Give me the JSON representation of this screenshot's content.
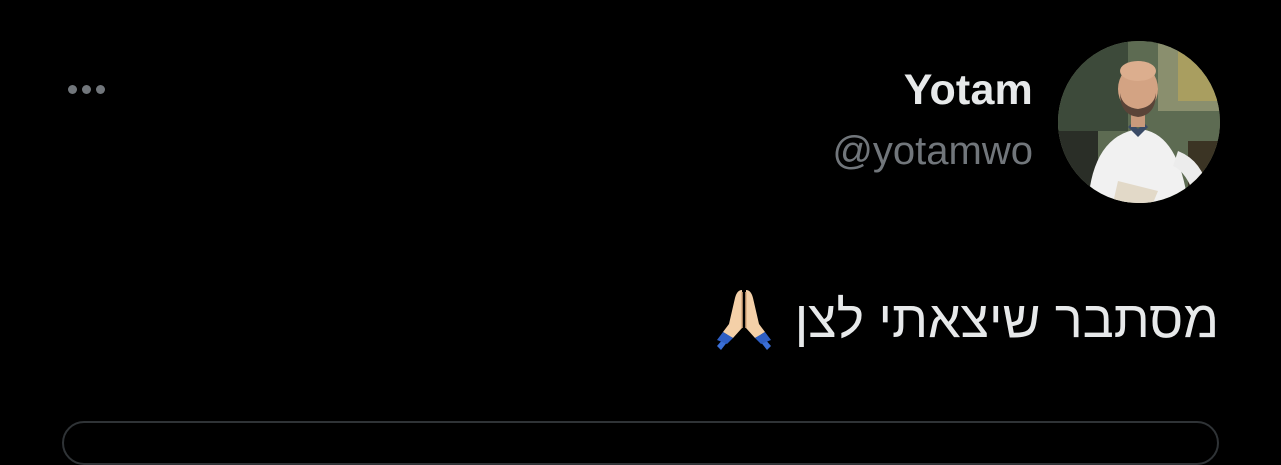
{
  "tweet": {
    "author": {
      "display_name": "Yotam",
      "handle": "@yotamwo"
    },
    "text": "מסתבר שיצאתי לצן",
    "emoji_icon": "folded-hands-icon"
  },
  "icons": {
    "more": "more-dots-icon"
  },
  "colors": {
    "background": "#000000",
    "primary_text": "#e7e9ea",
    "secondary_text": "#71767b",
    "border": "#2f3336"
  }
}
